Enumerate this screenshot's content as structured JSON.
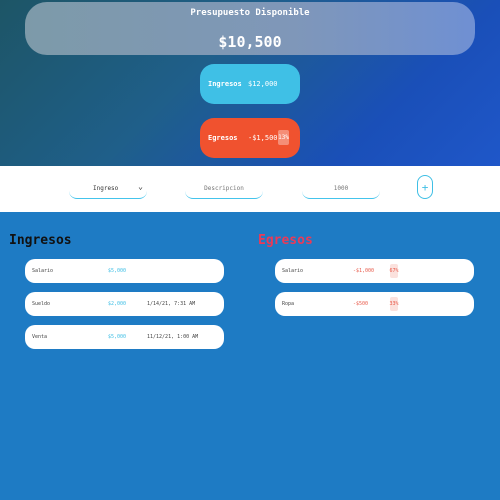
{
  "budget": {
    "title": "Presupuesto Disponible",
    "value": "$10,500"
  },
  "summary": {
    "income_label": "Ingresos",
    "income_value": "$12,000",
    "expense_label": "Egresos",
    "expense_value": "-$1,500",
    "expense_pct": "13%"
  },
  "form": {
    "type_selected": "Ingreso",
    "description_placeholder": "Descripcion",
    "amount_placeholder": "1000",
    "add_symbol": "+"
  },
  "income": {
    "title": "Ingresos",
    "items": [
      {
        "desc": "Salario",
        "value": "$5,000",
        "date": ""
      },
      {
        "desc": "Sueldo",
        "value": "$2,000",
        "date": "1/14/21, 7:31 AM"
      },
      {
        "desc": "Venta",
        "value": "$5,000",
        "date": "11/12/21, 1:00 AM"
      }
    ]
  },
  "expenses": {
    "title": "Egresos",
    "items": [
      {
        "desc": "Salario",
        "value": "-$1,000",
        "pct": "67%"
      },
      {
        "desc": "Ropa",
        "value": "-$500",
        "pct": "33%"
      }
    ]
  },
  "colors": {
    "income_accent": "#3fc0e6",
    "expense_accent": "#f0522f",
    "background": "#1e7bc4"
  }
}
